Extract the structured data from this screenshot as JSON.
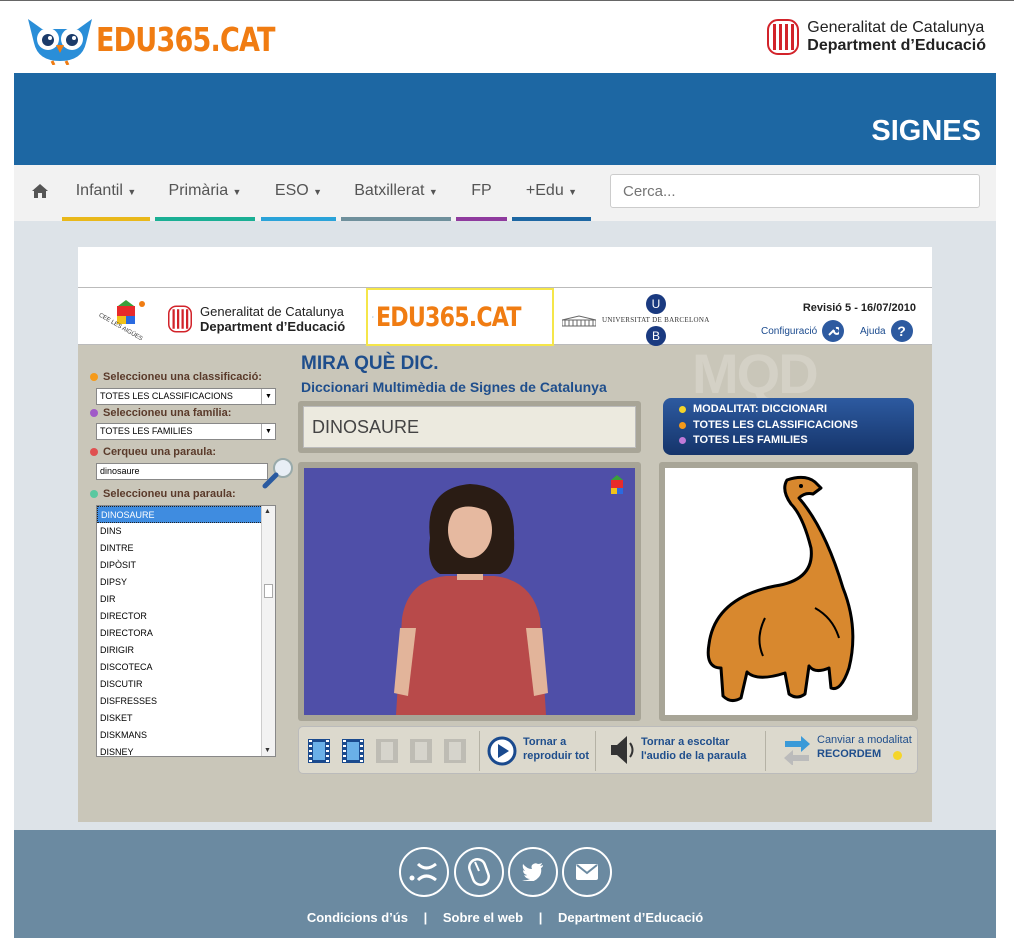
{
  "header": {
    "brand": "EDU365.CAT",
    "gov_line1": "Generalitat de Catalunya",
    "gov_line2": "Department d’Educació"
  },
  "banner": {
    "title": "SIGNES"
  },
  "nav": {
    "items": [
      {
        "label": "Infantil",
        "color": "#e9b81a"
      },
      {
        "label": "Primària",
        "color": "#1aaf94"
      },
      {
        "label": "ESO",
        "color": "#2aa3d9"
      },
      {
        "label": "Batxillerat",
        "color": "#6f909c"
      },
      {
        "label": "FP",
        "color": "#8f3b9e"
      },
      {
        "label": "+Edu",
        "color": "#1d67a3"
      }
    ],
    "search_placeholder": "Cerca..."
  },
  "app": {
    "cee_text": "CEE LES AIGÜES",
    "gov_line1": "Generalitat de Catalunya",
    "gov_line2": "Department d’Educació",
    "brand": "EDU365.CAT",
    "ub_text": "UNIVERSITAT DE BARCELONA",
    "ub_u": "U",
    "ub_b": "B",
    "revision": "Revisió 5 - 16/07/2010",
    "config": "Configuració",
    "help": "Ajuda",
    "help_glyph": "?",
    "title": "MIRA QUÈ DIC.",
    "subtitle": "Diccionari Multimèdia de Signes de Catalunya",
    "watermark": "MQD",
    "classification_label": "Seleccioneu una classificació:",
    "classification_value": "TOTES LES CLASSIFICACIONS",
    "family_label": "Seleccioneu una família:",
    "family_value": "TOTES LES FAMILIES",
    "search_label": "Cerqueu una paraula:",
    "search_value": "dinosaure",
    "word_label": "Seleccioneu una paraula:",
    "words": [
      "DINOSAURE",
      "DINS",
      "DINTRE",
      "DIPÒSIT",
      "DIPSY",
      "DIR",
      "DIRECTOR",
      "DIRECTORA",
      "DIRIGIR",
      "DISCOTECA",
      "DISCUTIR",
      "DISFRESSES",
      "DISKET",
      "DISKMANS",
      "DISNEY"
    ],
    "current_word": "DINOSAURE",
    "mode_lines": [
      "MODALITAT: DICCIONARI",
      "TOTES LES CLASSIFICACIONS",
      "TOTES LES FAMILIES"
    ],
    "replay_line1": "Tornar a",
    "replay_line2": "reproduir tot",
    "audio_line1": "Tornar a escoltar",
    "audio_line2": "l'audio de la paraula",
    "switch_line1": "Canviar a modalitat",
    "switch_line2": "RECORDEM"
  },
  "footer": {
    "links": [
      "Condicions d’ús",
      "Sobre el web",
      "Department d’Educació"
    ],
    "sep": "|"
  }
}
